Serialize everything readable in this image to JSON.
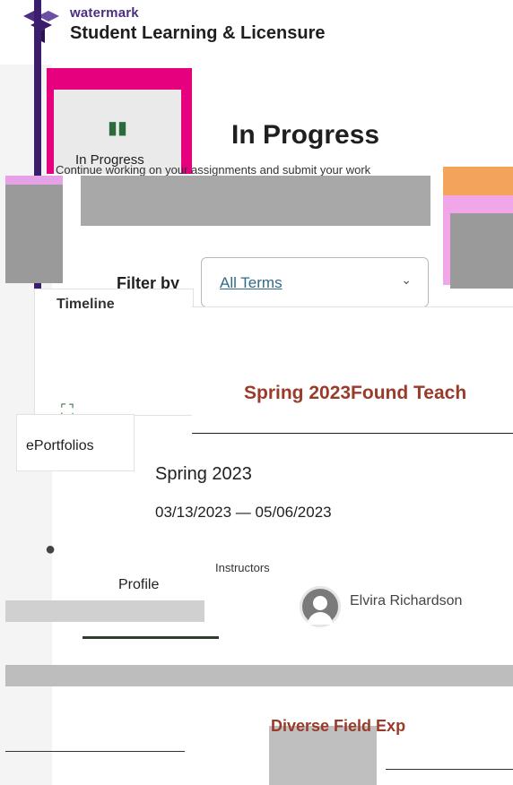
{
  "header": {
    "brand": "watermark",
    "product": "Student Learning & Licensure",
    "product_sub": "Student Learning & Licensure"
  },
  "nav": {
    "in_progress": "In Progress",
    "timeline": "Timeline",
    "eportfolios": "ePortfolios",
    "profile": "Profile"
  },
  "main": {
    "title": "In Progress",
    "subtitle": "Continue working on your assignments and submit your work",
    "filter_label": "Filter by",
    "filter_value": "All Terms"
  },
  "course": {
    "title": "Spring 2023Found Teach",
    "term": "Spring 2023",
    "dates": "03/13/2023 — 05/06/2023",
    "instructors_label": "Instructors",
    "instructor_name": "Elvira Richardson"
  },
  "next_course": {
    "title": "Diverse Field Exp"
  },
  "colors": {
    "brand_purple": "#4b2e83",
    "accent_magenta": "#e6007e",
    "course_title": "#9a3b2a",
    "nav_icon_green": "#2b6a3a"
  },
  "icons": {
    "in_progress": "book-icon",
    "eportfolios": "presentation-board-icon",
    "profile": "person-icon",
    "filter": "chevron-down-icon"
  }
}
